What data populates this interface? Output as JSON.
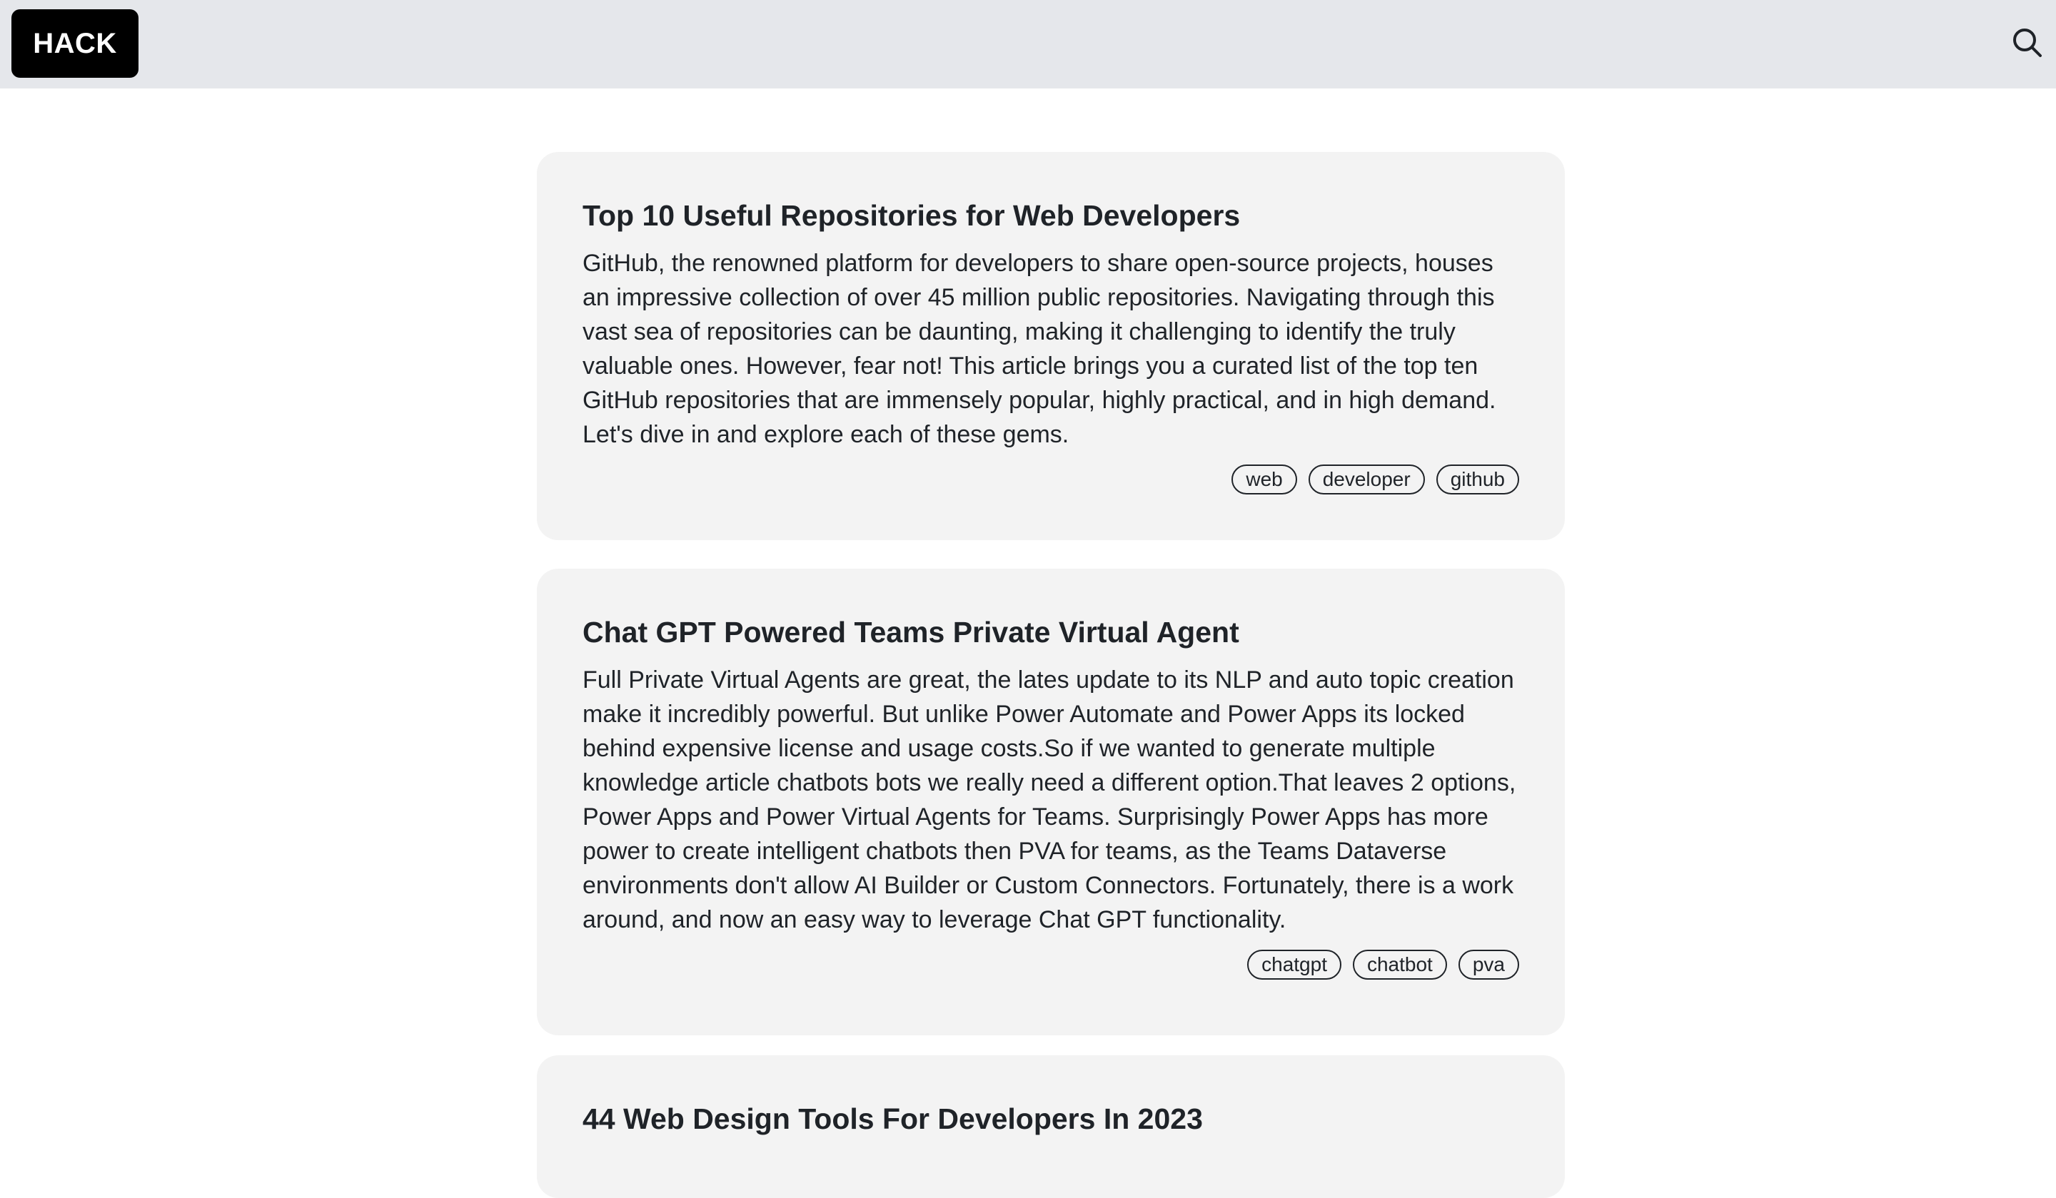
{
  "header": {
    "logo_text": "HACK",
    "background": "#e5e7eb",
    "search_icon": "search-icon"
  },
  "posts": [
    {
      "title": "Top 10 Useful Repositories for Web Developers",
      "excerpt": "GitHub, the renowned platform for developers to share open-source projects, houses an impressive collection of over 45 million public repositories. Navigating through this vast sea of repositories can be daunting, making it challenging to identify the truly valuable ones. However, fear not! This article brings you a curated list of the top ten GitHub repositories that are immensely popular, highly practical, and in high demand. Let's dive in and explore each of these gems.",
      "tags": [
        "web",
        "developer",
        "github"
      ]
    },
    {
      "title": "Chat GPT Powered Teams Private Virtual Agent",
      "excerpt": "Full Private Virtual Agents are great, the lates update to its NLP and auto topic creation make it incredibly powerful. But unlike Power Automate and Power Apps its locked behind expensive license and usage costs.So if we wanted to generate multiple knowledge article chatbots bots we really need a different option.That leaves 2 options, Power Apps and Power Virtual Agents for Teams. Surprisingly Power Apps has more power to create intelligent chatbots then PVA for teams, as the Teams Dataverse environments don't allow AI Builder or Custom Connectors. Fortunately, there is a work around, and now an easy way to leverage Chat GPT functionality.",
      "tags": [
        "chatgpt",
        "chatbot",
        "pva"
      ]
    },
    {
      "title": "44 Web Design Tools For Developers In 2023",
      "excerpt": "",
      "tags": []
    }
  ]
}
